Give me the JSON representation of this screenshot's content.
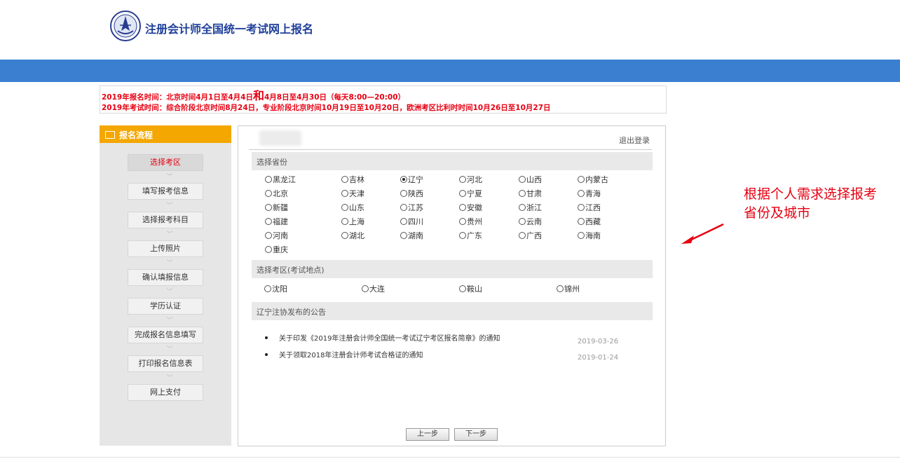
{
  "header": {
    "site_title": "注册会计师全国统一考试网上报名",
    "logo_icon": "cicpa-emblem-icon"
  },
  "notice": {
    "line1_part1": "2019年报名时间：北京时间4月1日至4月4日",
    "line1_big": "和",
    "line1_part2": "4月8日至4月30日（每天8:00—20:00）",
    "line2": "2019年考试时间：综合阶段北京时间8月24日，专业阶段北京时间10月19日至10月20日，欧洲考区比利时时间10月26日至10月27日"
  },
  "sidebar": {
    "title": "报名流程",
    "title_icon": "monitor-icon",
    "steps": [
      {
        "label": "选择考区",
        "active": true
      },
      {
        "label": "填写报考信息",
        "active": false
      },
      {
        "label": "选择报考科目",
        "active": false
      },
      {
        "label": "上传照片",
        "active": false
      },
      {
        "label": "确认填报信息",
        "active": false
      },
      {
        "label": "学历认证",
        "active": false
      },
      {
        "label": "完成报名信息填写",
        "active": false
      },
      {
        "label": "打印报名信息表",
        "active": false
      },
      {
        "label": "网上支付",
        "active": false
      }
    ]
  },
  "main": {
    "logout": "退出登录",
    "province_section": "选择省份",
    "provinces": [
      [
        "黑龙江",
        "吉林",
        "辽宁",
        "河北",
        "山西",
        "内蒙古"
      ],
      [
        "北京",
        "天津",
        "陕西",
        "宁夏",
        "甘肃",
        "青海"
      ],
      [
        "新疆",
        "山东",
        "江苏",
        "安徽",
        "浙江",
        "江西"
      ],
      [
        "福建",
        "上海",
        "四川",
        "贵州",
        "云南",
        "西藏"
      ],
      [
        "河南",
        "湖北",
        "湖南",
        "广东",
        "广西",
        "海南"
      ],
      [
        "重庆"
      ]
    ],
    "selected_province": "辽宁",
    "site_section": "选择考区(考试地点)",
    "sites": [
      "沈阳",
      "大连",
      "鞍山",
      "锦州"
    ],
    "announce_section": "辽宁注协发布的公告",
    "announcements": [
      {
        "title": "关于印发《2019年注册会计师全国统一考试辽宁考区报名简章》的通知",
        "date": "2019-03-26"
      },
      {
        "title": "关于领取2018年注册会计师考试合格证的通知",
        "date": "2019-01-24"
      }
    ],
    "prev_button": "上一步",
    "next_button": "下一步"
  },
  "callout": {
    "line1": "根据个人需求选择报考",
    "line2": "省份及城市"
  },
  "colors": {
    "header_bar": "#3a7fd0",
    "sidebar_head": "#f4a700",
    "notice_text": "#e60012",
    "title_text": "#1f3f9a"
  }
}
